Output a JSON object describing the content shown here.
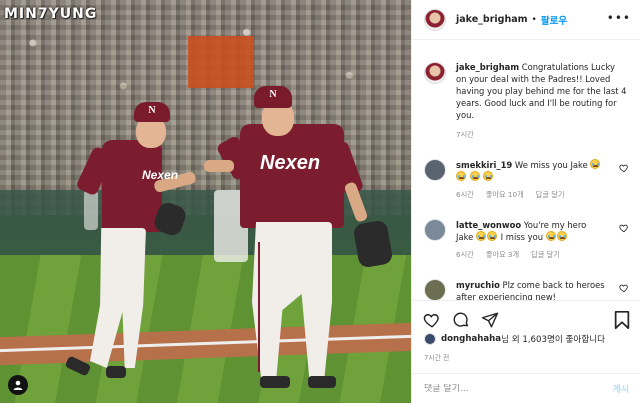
{
  "photo": {
    "watermark": "MIN7YUNG",
    "jersey_text_left": "Nexen",
    "jersey_text_right": "Nexen",
    "cap_letter": "N"
  },
  "post": {
    "author": "jake_brigham",
    "separator": "•",
    "follow_label": "팔로우",
    "caption": {
      "username": "jake_brigham",
      "text": "Congratulations Lucky on your deal with the Padres!! Loved having you play behind me for the last 4 years. Good luck and I'll be routing for you.",
      "time": "7시간"
    },
    "comments": [
      {
        "username": "smekkiri_19",
        "text": "We miss you Jake",
        "emoji_before": 0,
        "emoji_after": 1,
        "emoji_line2": 3,
        "line2_text": "",
        "time": "6시간",
        "likes": "좋아요 10개",
        "reply": "답글 달기",
        "avatar_color": "#5a6470"
      },
      {
        "username": "latte_wonwoo",
        "text": "You're my hero Jake",
        "emoji_after": 2,
        "line2_text": "I miss you",
        "emoji_line2": 2,
        "time": "6시간",
        "likes": "좋아요 3개",
        "reply": "답글 달기",
        "avatar_color": "#7a8a9a"
      },
      {
        "username": "myruchio",
        "text": "Plz come back to heroes after experiencing new!",
        "time": "",
        "likes": "",
        "reply": "",
        "avatar_color": "#6b6e50"
      }
    ],
    "likes_user": "donghahaha",
    "likes_text": "님 외 1,603명이 좋아합니다",
    "posted_time": "7시간 전",
    "comment_placeholder": "댓글 달기...",
    "post_label": "게시"
  },
  "icons": {
    "heart": "heart-icon",
    "comment": "comment-icon",
    "share": "share-icon",
    "bookmark": "bookmark-icon",
    "more": "more-options-icon",
    "user_tag": "user-tag-icon"
  },
  "colors": {
    "link_blue": "#0095f6",
    "post_disabled": "#b2dffc",
    "muted": "#8e8e8e",
    "team_maroon": "#7b1d2e"
  }
}
